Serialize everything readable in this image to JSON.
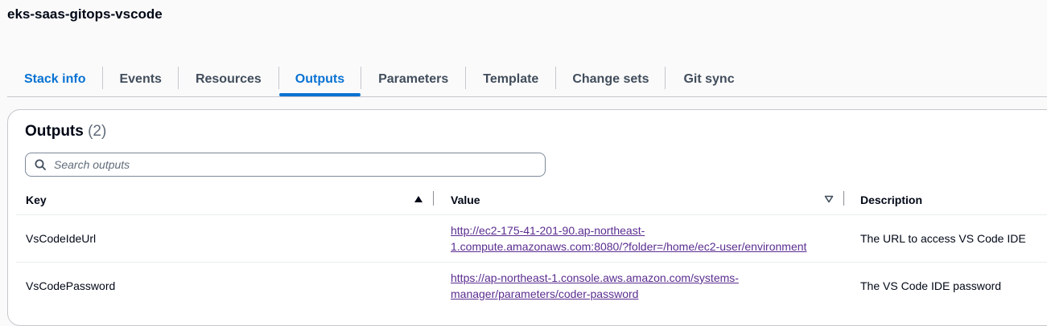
{
  "stack": {
    "title": "eks-saas-gitops-vscode"
  },
  "tabs": [
    {
      "label": "Stack info"
    },
    {
      "label": "Events"
    },
    {
      "label": "Resources"
    },
    {
      "label": "Outputs"
    },
    {
      "label": "Parameters"
    },
    {
      "label": "Template"
    },
    {
      "label": "Change sets"
    },
    {
      "label": "Git sync"
    }
  ],
  "active_tab": "Outputs",
  "outputs": {
    "title": "Outputs",
    "count": "(2)",
    "search_placeholder": "Search outputs",
    "columns": {
      "key": "Key",
      "value": "Value",
      "description": "Description"
    },
    "rows": [
      {
        "key": "VsCodeIdeUrl",
        "value_line1": "http://ec2-175-41-201-90.ap-northeast-",
        "value_line2": "1.compute.amazonaws.com:8080/?folder=/home/ec2-user/environment",
        "description": "The URL to access VS Code IDE"
      },
      {
        "key": "VsCodePassword",
        "value_line1": "https://ap-northeast-1.console.aws.amazon.com/systems-",
        "value_line2": "manager/parameters/coder-password",
        "description": "The VS Code IDE password"
      }
    ]
  },
  "colors": {
    "accent": "#0972d3",
    "link_visited": "#5b2d90",
    "border": "#c6c6cd"
  }
}
